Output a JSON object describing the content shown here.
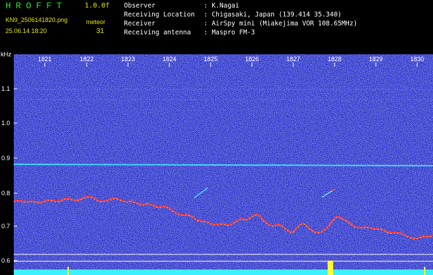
{
  "header": {
    "brand": "HROFFT",
    "version": "1.0.0f",
    "filename": "KN9_2506141820.png",
    "date_time": "25.06.14 18:20",
    "meteor_label": "meteor",
    "meteor_count": "31"
  },
  "station": {
    "rows": [
      {
        "label": "Observer",
        "value": ": K.Nagai"
      },
      {
        "label": "Receiving Location",
        "value": ": Chigasaki, Japan (139.414 35.340)"
      },
      {
        "label": "Receiver",
        "value": ": AirSpy mini (Miakejima VOR 108.65MHz)"
      },
      {
        "label": "Receiving antenna",
        "value": ": Maspro FM-3"
      }
    ]
  },
  "axis": {
    "unit": "kHz",
    "yticks": [
      "1.1",
      "1.0",
      "0.9",
      "0.8",
      "0.7",
      "0.6"
    ],
    "xticks": [
      "1821",
      "1822",
      "1823",
      "1824",
      "1825",
      "1826",
      "1827",
      "1828",
      "1829",
      "1830"
    ]
  },
  "colors": {
    "background": "#1a1fc8",
    "yellow": "#e8e800",
    "green": "#2ee82e",
    "cyan": "#3cf0ff",
    "red": "#ff3b3b"
  }
}
